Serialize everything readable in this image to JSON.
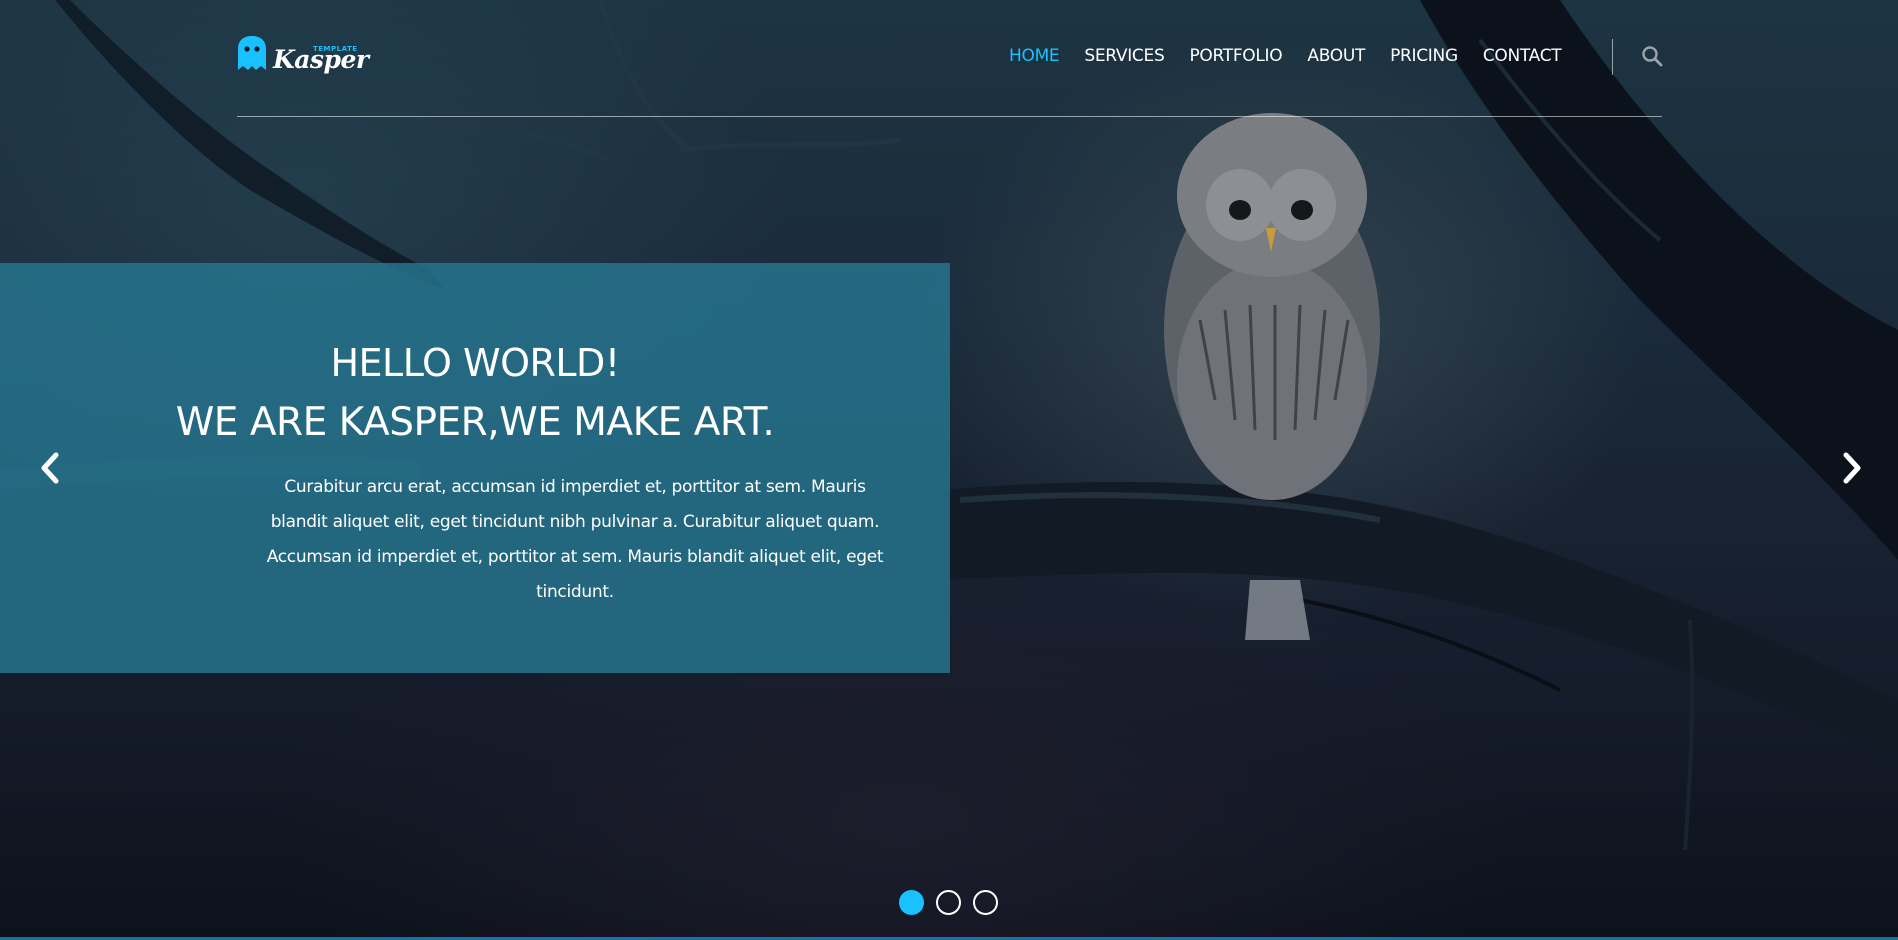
{
  "brand": {
    "name": "Kasper",
    "tagline": "TEMPLATE",
    "accent_color": "#19c1ff"
  },
  "nav": {
    "items": [
      {
        "label": "HOME",
        "active": true
      },
      {
        "label": "SERVICES",
        "active": false
      },
      {
        "label": "PORTFOLIO",
        "active": false
      },
      {
        "label": "ABOUT",
        "active": false
      },
      {
        "label": "PRICING",
        "active": false
      },
      {
        "label": "CONTACT",
        "active": false
      }
    ],
    "search_icon": "search-icon"
  },
  "slider": {
    "title_line1": "HELLO WORLD!",
    "title_line2": "WE ARE KASPER,WE MAKE ART.",
    "text": "Curabitur arcu erat, accumsan id imperdiet et, porttitor at sem. Mauris blandit aliquet elit, eget tincidunt nibh pulvinar a. Curabitur aliquet quam. Accumsan id imperdiet et, porttitor at sem. Mauris blandit aliquet elit, eget tincidunt.",
    "prev_icon": "chevron-left-icon",
    "next_icon": "chevron-right-icon",
    "slide_count": 3,
    "active_slide": 1,
    "box_color": "#267690"
  }
}
